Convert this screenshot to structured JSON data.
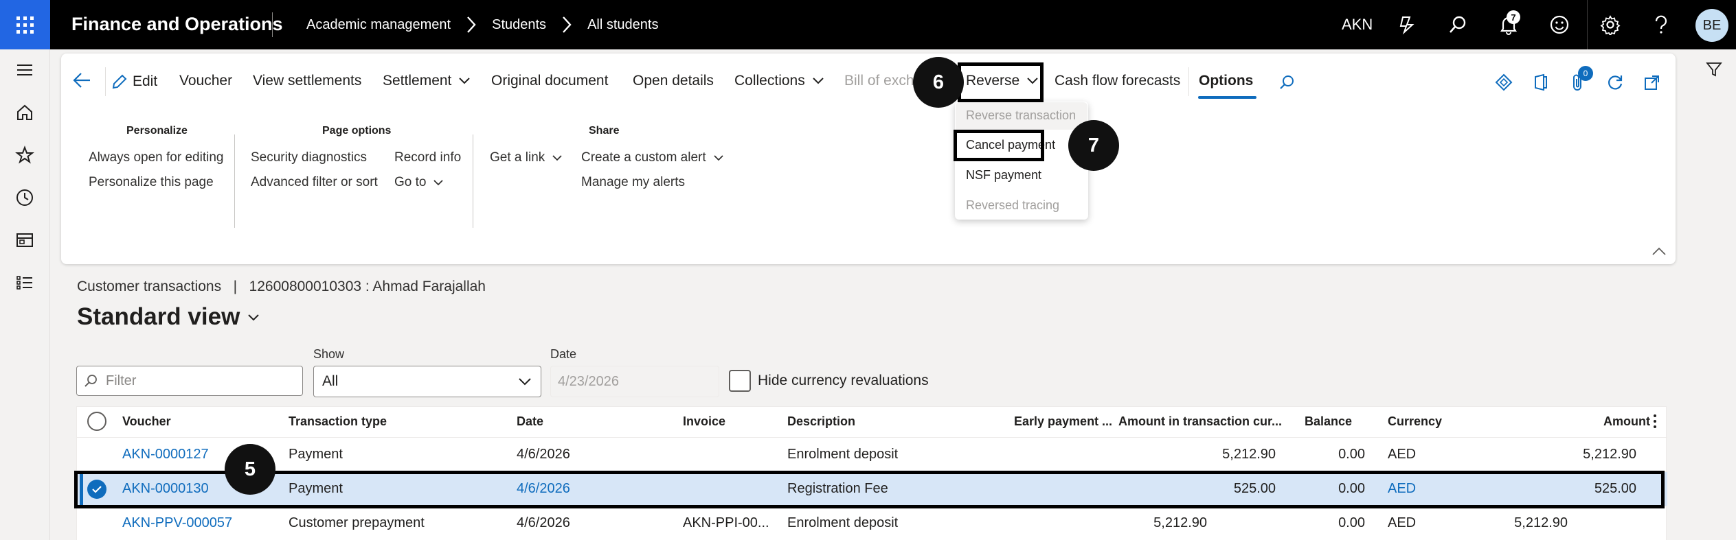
{
  "topbar": {
    "app_name": "Finance and Operations",
    "breadcrumb": [
      "Academic management",
      "Students",
      "All students"
    ],
    "company": "AKN",
    "notification_count": "7",
    "user_initials": "BE"
  },
  "actionpane": {
    "edit": "Edit",
    "voucher": "Voucher",
    "view_settlements": "View settlements",
    "settlement": "Settlement",
    "original_document": "Original document",
    "open_details": "Open details",
    "collections": "Collections",
    "bill_of_exchange": "Bill of exch",
    "reverse": "Reverse",
    "cash_flow_forecasts": "Cash flow forecasts",
    "options": "Options",
    "attachments_count": "0",
    "groups": {
      "personalize": {
        "title": "Personalize",
        "items": [
          "Always open for editing",
          "Personalize this page"
        ]
      },
      "page_options": {
        "title": "Page options",
        "items": [
          "Security diagnostics",
          "Advanced filter or sort",
          "Record info",
          "Go to"
        ]
      },
      "share": {
        "title": "Share",
        "items": [
          "Get a link",
          "Create a custom alert",
          "Manage my alerts"
        ]
      }
    }
  },
  "reverse_menu": {
    "items": [
      "Reverse transaction",
      "Cancel payment",
      "NSF payment",
      "Reversed tracing"
    ]
  },
  "steps": {
    "five": "5",
    "six": "6",
    "seven": "7"
  },
  "content": {
    "subtitle": "Customer transactions   |   12600800010303 : Ahmad Farajallah",
    "view_title": "Standard view",
    "filter_placeholder": "Filter",
    "show_label": "Show",
    "show_value": "All",
    "date_label": "Date",
    "date_value": "4/23/2026",
    "hide_currency_label": "Hide currency revaluations"
  },
  "grid": {
    "columns": [
      "Voucher",
      "Transaction type",
      "Date",
      "Invoice",
      "Description",
      "Early payment ...",
      "Amount in transaction cur...",
      "Balance",
      "Currency",
      "Amount"
    ],
    "rows": [
      {
        "voucher": "AKN-0000127",
        "type": "Payment",
        "date": "4/6/2026",
        "invoice": "",
        "description": "Enrolment deposit",
        "early": "",
        "amount_tc": "5,212.90",
        "balance": "0.00",
        "currency": "AED",
        "amount": "5,212.90"
      },
      {
        "voucher": "AKN-0000130",
        "type": "Payment",
        "date": "4/6/2026",
        "invoice": "",
        "description": "Registration Fee",
        "early": "",
        "amount_tc": "525.00",
        "balance": "0.00",
        "currency": "AED",
        "amount": "525.00"
      },
      {
        "voucher": "AKN-PPV-000057",
        "type": "Customer prepayment",
        "date": "4/6/2026",
        "invoice": "AKN-PPI-00...",
        "description": "Enrolment deposit",
        "early": "",
        "amount_tc": "5,212.90",
        "balance": "0.00",
        "currency": "AED",
        "amount": "5,212.90"
      }
    ]
  },
  "colors": {
    "accent": "#0f6cbd",
    "waffle": "#2266e3",
    "selected_row": "#d7e6f7"
  }
}
